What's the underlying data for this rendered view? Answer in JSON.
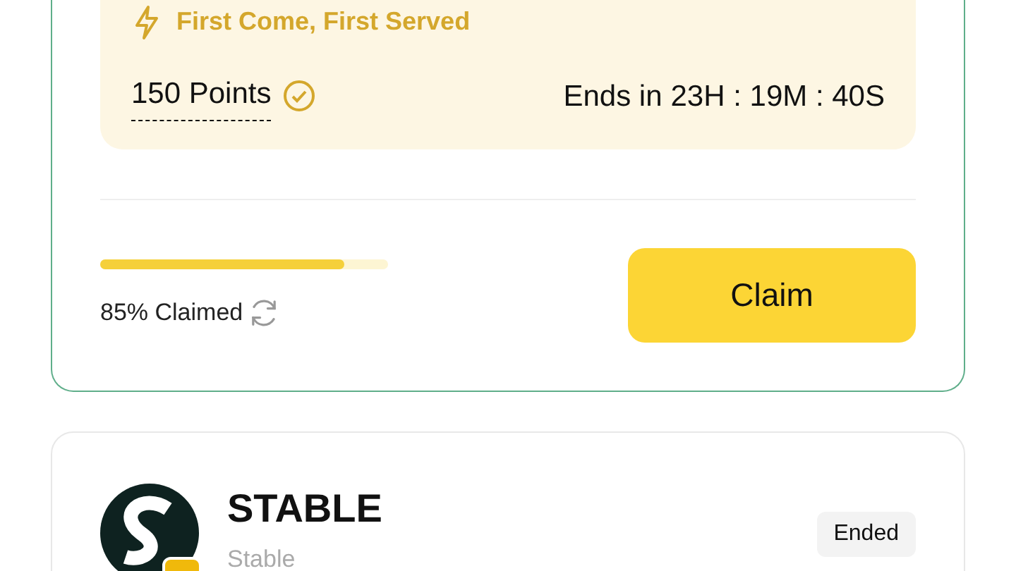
{
  "offer_card": {
    "tag": "First Come, First Served",
    "points": "150 Points",
    "verified": true,
    "ends_label": "Ends in",
    "countdown": "23H : 19M : 40S",
    "progress": {
      "level": 0.85
    },
    "claimed_text": "85% Claimed",
    "claim_button": "Claim"
  },
  "project_card": {
    "name": "STABLE",
    "subtitle": "Stable",
    "status": "Ended"
  }
}
